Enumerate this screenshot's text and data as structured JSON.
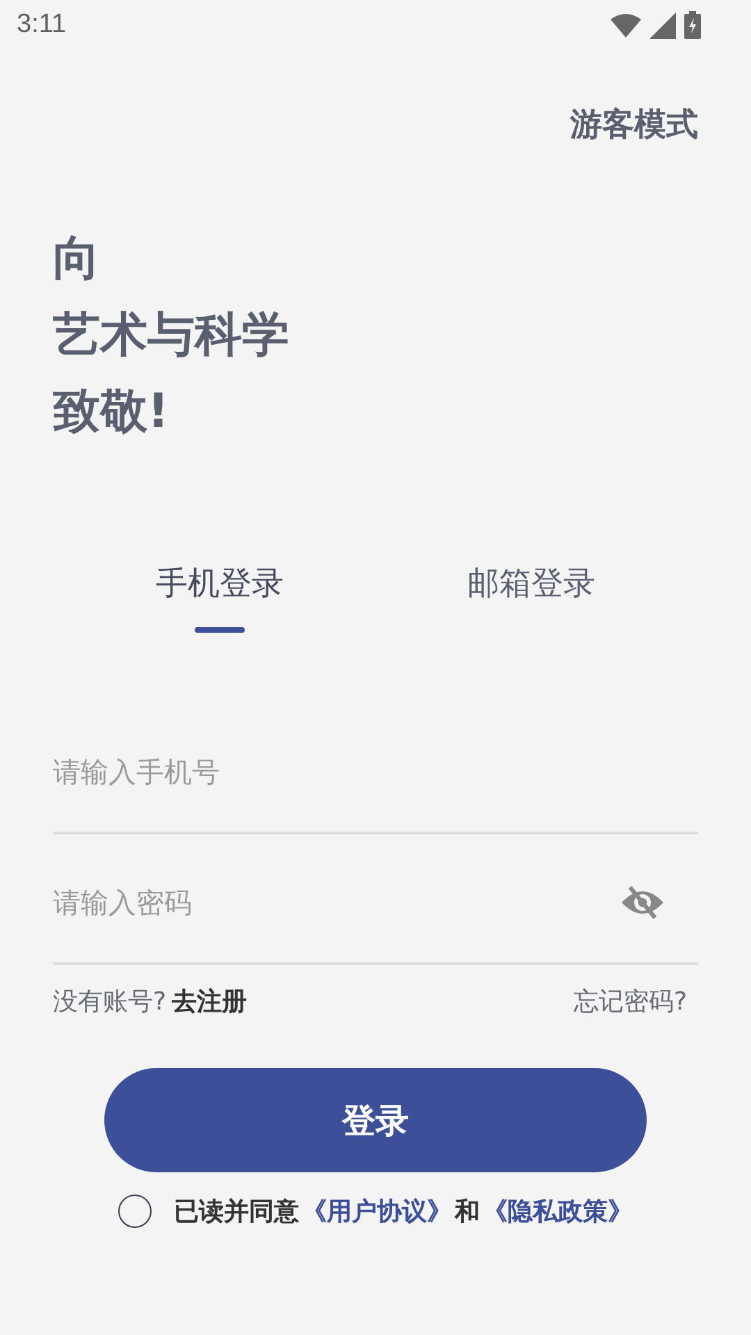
{
  "status_bar": {
    "time": "3:11"
  },
  "guest_mode": "游客模式",
  "headline": [
    "向",
    "艺术与科学",
    "致敬!"
  ],
  "tabs": [
    {
      "label": "手机登录",
      "selected": true
    },
    {
      "label": "邮箱登录",
      "selected": false
    }
  ],
  "fields": [
    {
      "placeholder": "请输入手机号",
      "kind": "phone"
    },
    {
      "placeholder": "请输入密码",
      "kind": "password",
      "visible": false
    }
  ],
  "register": {
    "prompt": "没有账号?",
    "link": "去注册"
  },
  "forgot_password": "忘记密码?",
  "login_button": "登录",
  "agreement": {
    "checked": false,
    "text": "已读并同意",
    "user_agreement": "《用户协议》",
    "and": "和",
    "privacy_policy": "《隐私政策》"
  }
}
